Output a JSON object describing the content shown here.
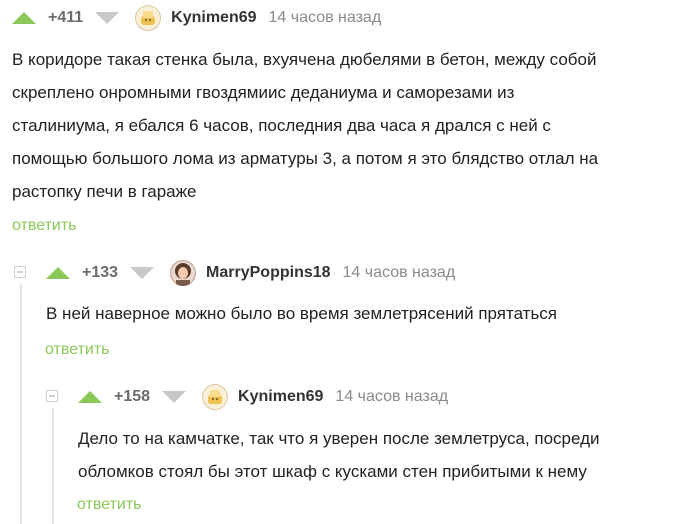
{
  "comments": [
    {
      "rating": "+411",
      "author": "Kynimen69",
      "time": "14 часов назад",
      "lines": [
        "В коридоре такая стенка была, вхуячена дюбелями в бетон, между собой",
        "скреплено онромными гвоздямиис деданиума и саморезами из",
        "сталиниума, я ебался 6 часов, последния два часа я дрался с ней с",
        "помощью большого лома из арматуры 3, а потом я это блядство отлал на",
        "растопку печи в гараже"
      ],
      "reply_label": "ответить"
    },
    {
      "rating": "+133",
      "author": "MarryPoppins18",
      "time": "14 часов назад",
      "lines": [
        "В ней наверное можно было во время землетрясений прятаться"
      ],
      "reply_label": "ответить"
    },
    {
      "rating": "+158",
      "author": "Kynimen69",
      "time": "14 часов назад",
      "lines": [
        "Дело то на камчатке, так что я уверен после землетруса, посреди",
        "обломков стоял бы этот шкаф с кусками стен прибитыми к нему"
      ],
      "reply_label": "ответить"
    }
  ],
  "colors": {
    "upvote": "#8ac858",
    "downvote": "#c8c8c8",
    "reply_link": "#8ac858",
    "thread_line": "#e4e4e4"
  },
  "icons": [
    "upvote-arrow-icon",
    "downvote-arrow-icon",
    "collapse-thread-icon"
  ]
}
